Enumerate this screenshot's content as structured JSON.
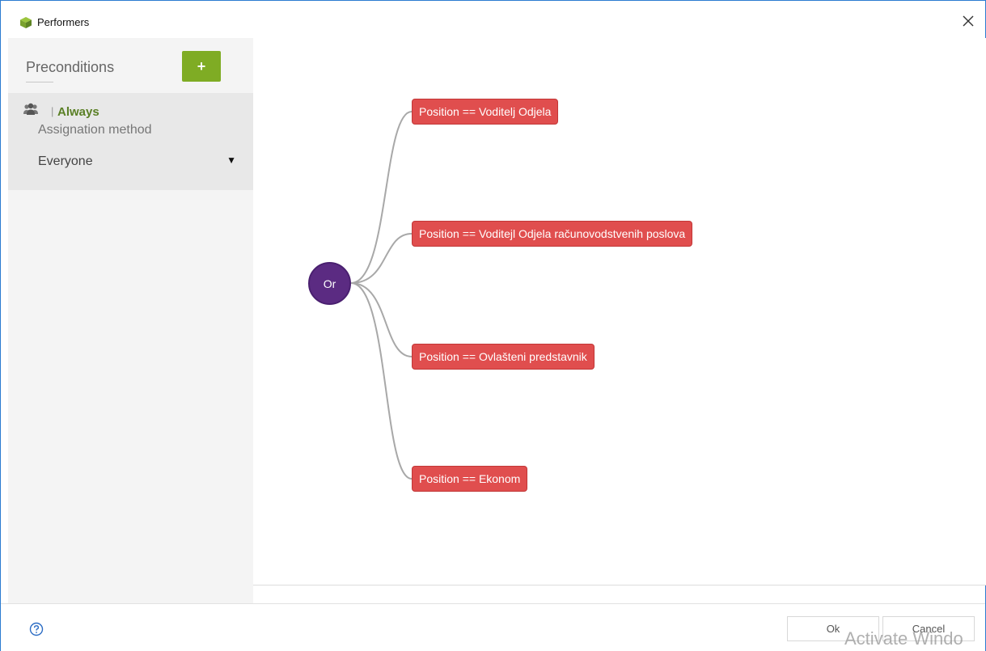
{
  "window": {
    "title": "Performers",
    "close_icon": "close-icon",
    "app_icon": "cube-app-icon"
  },
  "sidebar": {
    "title": "Preconditions",
    "add_label": "+",
    "items": [
      {
        "icon": "users-icon",
        "separator": "|",
        "name": "Always",
        "method_label": "Assignation method",
        "method_value": "Everyone",
        "caret": "▼"
      }
    ]
  },
  "canvas": {
    "root": {
      "label": "Or",
      "color": "#5b2b82"
    },
    "conditions": [
      {
        "label": "Position == Voditelj Odjela"
      },
      {
        "label": "Position == Voditejl Odjela računovodstvenih poslova"
      },
      {
        "label": "Position == Ovlašteni predstavnik"
      },
      {
        "label": "Position == Ekonom"
      }
    ],
    "condition_color": "#e04e4e"
  },
  "footer": {
    "help_icon": "help-circle-icon",
    "ok_label": "Ok",
    "cancel_label": "Cancel",
    "watermark": "Activate Windo"
  },
  "colors": {
    "accent_green": "#7fac24",
    "item_name_green": "#5a7f25",
    "window_border": "#2b7bd1"
  }
}
